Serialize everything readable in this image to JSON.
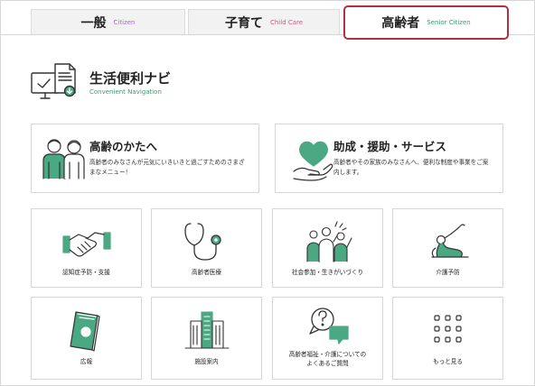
{
  "tabs": [
    {
      "label": "一般",
      "sub": "Citizen"
    },
    {
      "label": "子育て",
      "sub": "Child Care"
    },
    {
      "label": "高齢者",
      "sub": "Senior Citizen"
    }
  ],
  "header": {
    "title": "生活便利ナビ",
    "subtitle": "Convenient Navigation"
  },
  "feature_cards": [
    {
      "title": "高齢のかたへ",
      "description": "高齢者のみなさんが元気にいきいきと過ごすためのさまざまなメニュー！"
    },
    {
      "title": "助成・援助・サービス",
      "description": "高齢者やその家族のみなさんへ、便利な制度や事業をご案内します。"
    }
  ],
  "menu_items": [
    {
      "label": "認知症予防・支援"
    },
    {
      "label": "高齢者医療"
    },
    {
      "label": "社会参加・生きがいづくり"
    },
    {
      "label": "介護予防"
    },
    {
      "label": "広報"
    },
    {
      "label": "施設案内"
    },
    {
      "label_line1": "高齢者福祉・介護についての",
      "label_line2": "よくあるご質問"
    },
    {
      "label": "もっと見る"
    }
  ],
  "colors": {
    "accent_green": "#4aa882",
    "active_border": "#b0303f",
    "sub_purple": "#a86ac6",
    "sub_pink": "#e0508a"
  }
}
